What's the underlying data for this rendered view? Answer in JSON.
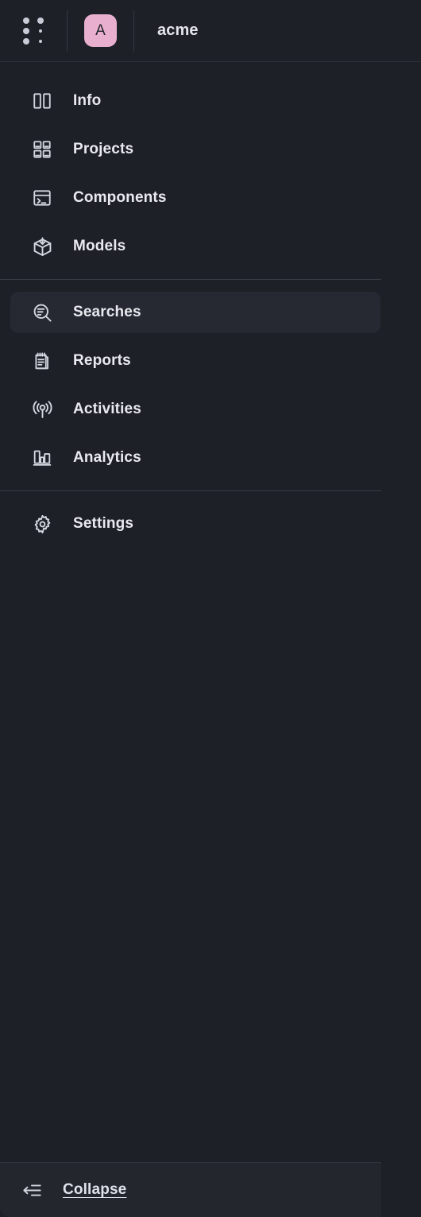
{
  "header": {
    "logo_icon": "dot-grid-logo-icon",
    "avatar_letter": "A",
    "avatar_color": "#e8b0ce",
    "org_name": "acme"
  },
  "nav": {
    "groups": [
      {
        "items": [
          {
            "label": "Info",
            "icon": "panel-layout-icon",
            "active": false
          },
          {
            "label": "Projects",
            "icon": "grid-squares-icon",
            "active": false
          },
          {
            "label": "Components",
            "icon": "terminal-window-icon",
            "active": false
          },
          {
            "label": "Models",
            "icon": "box-download-icon",
            "active": false
          }
        ]
      },
      {
        "items": [
          {
            "label": "Searches",
            "icon": "search-list-icon",
            "active": true
          },
          {
            "label": "Reports",
            "icon": "notepad-icon",
            "active": false
          },
          {
            "label": "Activities",
            "icon": "broadcast-icon",
            "active": false
          },
          {
            "label": "Analytics",
            "icon": "bar-chart-icon",
            "active": false
          }
        ]
      },
      {
        "items": [
          {
            "label": "Settings",
            "icon": "gear-icon",
            "active": false
          }
        ]
      }
    ]
  },
  "footer": {
    "label": "Collapse",
    "icon": "collapse-left-icon"
  },
  "colors": {
    "background": "#1e2027",
    "active_item": "#262932",
    "footer_background": "#24262e",
    "divider": "#3a3d47",
    "text": "#e8eaf0",
    "icon": "#d3d7e0",
    "accent": "#e8b0ce"
  }
}
